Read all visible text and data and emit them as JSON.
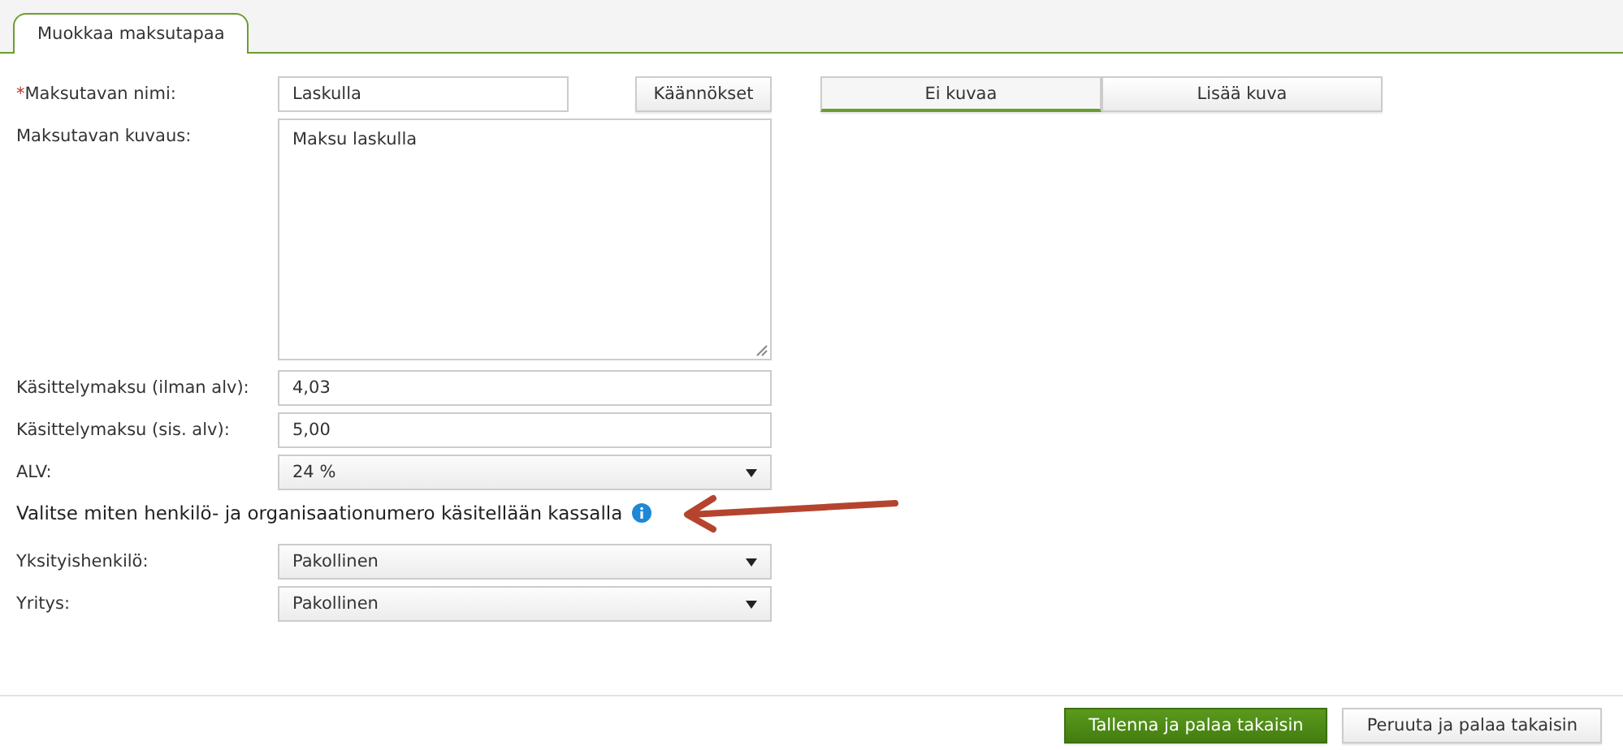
{
  "tabs": [
    {
      "label": "Muokkaa maksutapaa",
      "selected": true
    }
  ],
  "translations_button": "Käännökset",
  "image_options": [
    {
      "label": "Ei kuvaa",
      "selected": true
    },
    {
      "label": "Lisää kuva",
      "selected": false
    }
  ],
  "fields": [
    {
      "kind": "text",
      "required_mark": "*",
      "label": "Maksutavan nimi:",
      "value": "Laskulla"
    },
    {
      "kind": "textarea",
      "label": "Maksutavan kuvaus:",
      "value": "Maksu laskulla"
    },
    {
      "kind": "text",
      "label": "Käsittelymaksu (ilman alv):",
      "value": "4,03"
    },
    {
      "kind": "text",
      "label": "Käsittelymaksu (sis. alv):",
      "value": "5,00"
    },
    {
      "kind": "select",
      "label": "ALV:",
      "value": "24 %"
    },
    {
      "kind": "heading",
      "label": "Valitse miten henkilö- ja organisaationumero käsitellään kassalla"
    },
    {
      "kind": "select",
      "label": "Yksityishenkilö:",
      "value": "Pakollinen"
    },
    {
      "kind": "select",
      "label": "Yritys:",
      "value": "Pakollinen"
    }
  ],
  "buttons": [
    {
      "kind": "primary",
      "label": "Tallenna ja palaa takaisin"
    },
    {
      "kind": "secondary",
      "label": "Peruuta ja palaa takaisin"
    }
  ]
}
